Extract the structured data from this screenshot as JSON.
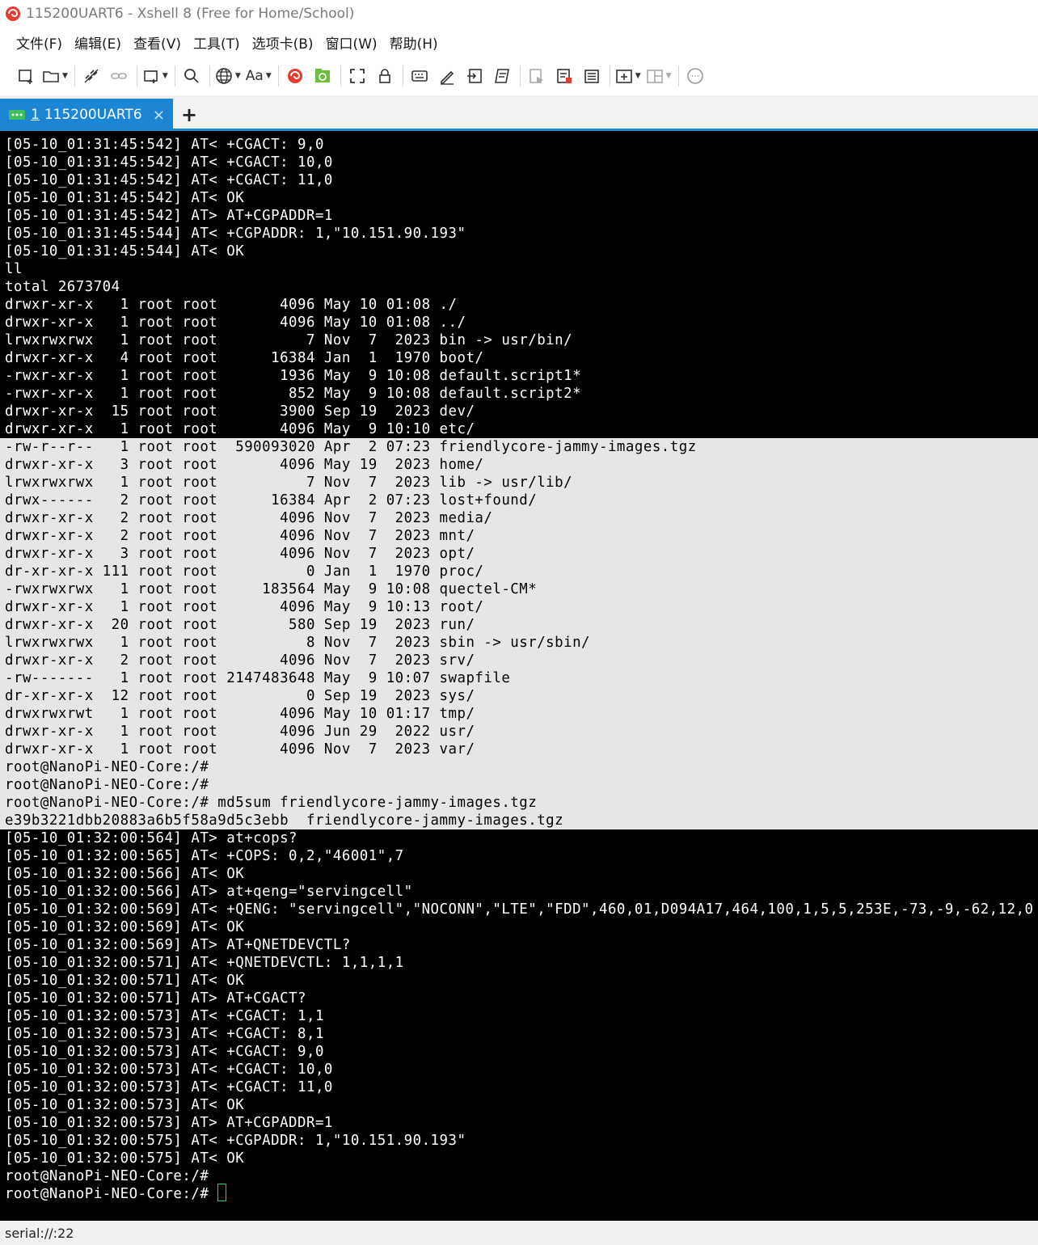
{
  "window": {
    "title": "115200UART6 - Xshell 8 (Free for Home/School)"
  },
  "menu": {
    "items": [
      "文件(F)",
      "编辑(E)",
      "查看(V)",
      "工具(T)",
      "选项卡(B)",
      "窗口(W)",
      "帮助(H)"
    ]
  },
  "toolbar": {
    "font_label": "Aa",
    "icons": [
      "new-session-icon",
      "open-folder-icon",
      "disconnect-icon",
      "reconnect-icon",
      "new-window-icon",
      "search-icon",
      "globe-icon",
      "font-icon",
      "xshell-icon",
      "xftp-icon",
      "fullscreen-icon",
      "lock-icon",
      "keyboard-icon",
      "compose-icon",
      "transfer-icon",
      "script-icon",
      "log-icon",
      "stop-icon",
      "notes-icon",
      "add-tab-icon",
      "layout-icon",
      "chat-icon"
    ]
  },
  "tab": {
    "number": "1",
    "label": "115200UART6",
    "close": "×",
    "add": "+"
  },
  "terminal": {
    "lines": [
      "[05-10_01:31:45:542] AT< +CGACT: 9,0",
      "[05-10_01:31:45:542] AT< +CGACT: 10,0",
      "[05-10_01:31:45:542] AT< +CGACT: 11,0",
      "[05-10_01:31:45:542] AT< OK",
      "[05-10_01:31:45:542] AT> AT+CGPADDR=1",
      "[05-10_01:31:45:544] AT< +CGPADDR: 1,\"10.151.90.193\"",
      "[05-10_01:31:45:544] AT< OK",
      "ll",
      "total 2673704",
      "drwxr-xr-x   1 root root       4096 May 10 01:08 ./",
      "drwxr-xr-x   1 root root       4096 May 10 01:08 ../",
      "lrwxrwxrwx   1 root root          7 Nov  7  2023 bin -> usr/bin/",
      "drwxr-xr-x   4 root root      16384 Jan  1  1970 boot/",
      "-rwxr-xr-x   1 root root       1936 May  9 10:08 default.script1*",
      "-rwxr-xr-x   1 root root        852 May  9 10:08 default.script2*",
      "drwxr-xr-x  15 root root       3900 Sep 19  2023 dev/",
      "drwxr-xr-x   1 root root       4096 May  9 10:10 etc/",
      "-rw-r--r--   1 root root  590093020 Apr  2 07:23 friendlycore-jammy-images.tgz",
      "drwxr-xr-x   3 root root       4096 May 19  2023 home/",
      "lrwxrwxrwx   1 root root          7 Nov  7  2023 lib -> usr/lib/",
      "drwx------   2 root root      16384 Apr  2 07:23 lost+found/",
      "drwxr-xr-x   2 root root       4096 Nov  7  2023 media/",
      "drwxr-xr-x   2 root root       4096 Nov  7  2023 mnt/",
      "drwxr-xr-x   3 root root       4096 Nov  7  2023 opt/",
      "dr-xr-xr-x 111 root root          0 Jan  1  1970 proc/",
      "-rwxrwxrwx   1 root root     183564 May  9 10:08 quectel-CM*",
      "drwxr-xr-x   1 root root       4096 May  9 10:13 root/",
      "drwxr-xr-x  20 root root        580 Sep 19  2023 run/",
      "lrwxrwxrwx   1 root root          8 Nov  7  2023 sbin -> usr/sbin/",
      "drwxr-xr-x   2 root root       4096 Nov  7  2023 srv/",
      "-rw-------   1 root root 2147483648 May  9 10:07 swapfile",
      "dr-xr-xr-x  12 root root          0 Sep 19  2023 sys/",
      "drwxrwxrwt   1 root root       4096 May 10 01:17 tmp/",
      "drwxr-xr-x   1 root root       4096 Jun 29  2022 usr/",
      "drwxr-xr-x   1 root root       4096 Nov  7  2023 var/",
      "root@NanoPi-NEO-Core:/#",
      "root@NanoPi-NEO-Core:/#",
      "root@NanoPi-NEO-Core:/# md5sum friendlycore-jammy-images.tgz",
      "e39b3221dbb20883a6b5f58a9d5c3ebb  friendlycore-jammy-images.tgz",
      "[05-10_01:32:00:564] AT> at+cops?",
      "[05-10_01:32:00:565] AT< +COPS: 0,2,\"46001\",7",
      "[05-10_01:32:00:566] AT< OK",
      "[05-10_01:32:00:566] AT> at+qeng=\"servingcell\"",
      "[05-10_01:32:00:569] AT< +QENG: \"servingcell\",\"NOCONN\",\"LTE\",\"FDD\",460,01,D094A17,464,100,1,5,5,253E,-73,-9,-62,12,0",
      "[05-10_01:32:00:569] AT< OK",
      "[05-10_01:32:00:569] AT> AT+QNETDEVCTL?",
      "[05-10_01:32:00:571] AT< +QNETDEVCTL: 1,1,1,1",
      "[05-10_01:32:00:571] AT< OK",
      "[05-10_01:32:00:571] AT> AT+CGACT?",
      "[05-10_01:32:00:573] AT< +CGACT: 1,1",
      "[05-10_01:32:00:573] AT< +CGACT: 8,1",
      "[05-10_01:32:00:573] AT< +CGACT: 9,0",
      "[05-10_01:32:00:573] AT< +CGACT: 10,0",
      "[05-10_01:32:00:573] AT< +CGACT: 11,0",
      "[05-10_01:32:00:573] AT< OK",
      "[05-10_01:32:00:573] AT> AT+CGPADDR=1",
      "[05-10_01:32:00:575] AT< +CGPADDR: 1,\"10.151.90.193\"",
      "[05-10_01:32:00:575] AT< OK",
      "root@NanoPi-NEO-Core:/#",
      "root@NanoPi-NEO-Core:/# "
    ],
    "selection_start": 17,
    "selection_end": 38
  },
  "statusbar": {
    "text": "serial://:22"
  },
  "colors": {
    "accent": "#1c86d6",
    "terminal_bg": "#000000",
    "terminal_fg": "#ffffff",
    "selection_bg": "#e6e6e6",
    "cursor": "#1fd56b"
  }
}
